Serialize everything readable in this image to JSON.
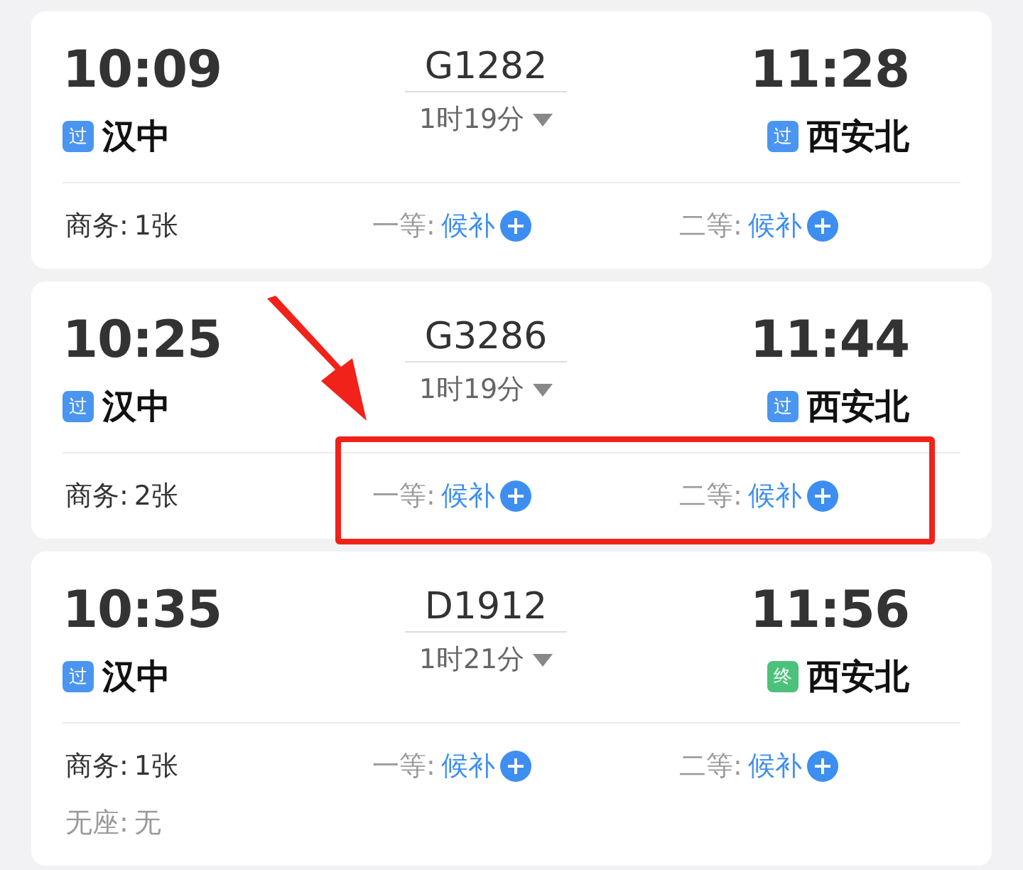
{
  "trains": [
    {
      "depart_time": "10:09",
      "depart_station": {
        "badge": "过",
        "color": "#4a95f0",
        "name": "汉中"
      },
      "number": "G1282",
      "duration": "1时19分",
      "arrive_time": "11:28",
      "arrive_station": {
        "badge": "过",
        "color": "#4a95f0",
        "name": "西安北"
      },
      "seats": [
        {
          "kind": "available",
          "label": "商务:",
          "status": "1张"
        },
        {
          "kind": "waitlist",
          "label": "一等:",
          "status": "候补"
        },
        {
          "kind": "waitlist",
          "label": "二等:",
          "status": "候补"
        }
      ],
      "highlighted": false
    },
    {
      "depart_time": "10:25",
      "depart_station": {
        "badge": "过",
        "color": "#4a95f0",
        "name": "汉中"
      },
      "number": "G3286",
      "duration": "1时19分",
      "arrive_time": "11:44",
      "arrive_station": {
        "badge": "过",
        "color": "#4a95f0",
        "name": "西安北"
      },
      "seats": [
        {
          "kind": "available",
          "label": "商务:",
          "status": "2张"
        },
        {
          "kind": "waitlist",
          "label": "一等:",
          "status": "候补"
        },
        {
          "kind": "waitlist",
          "label": "二等:",
          "status": "候补"
        }
      ],
      "highlighted": true
    },
    {
      "depart_time": "10:35",
      "depart_station": {
        "badge": "过",
        "color": "#4a95f0",
        "name": "汉中"
      },
      "number": "D1912",
      "duration": "1时21分",
      "arrive_time": "11:56",
      "arrive_station": {
        "badge": "终",
        "color": "#4cc17a",
        "name": "西安北"
      },
      "seats": [
        {
          "kind": "available",
          "label": "商务:",
          "status": "1张"
        },
        {
          "kind": "waitlist",
          "label": "一等:",
          "status": "候补"
        },
        {
          "kind": "waitlist",
          "label": "二等:",
          "status": "候补"
        },
        {
          "kind": "none",
          "label": "无座:",
          "status": "无"
        }
      ],
      "highlighted": false
    }
  ]
}
